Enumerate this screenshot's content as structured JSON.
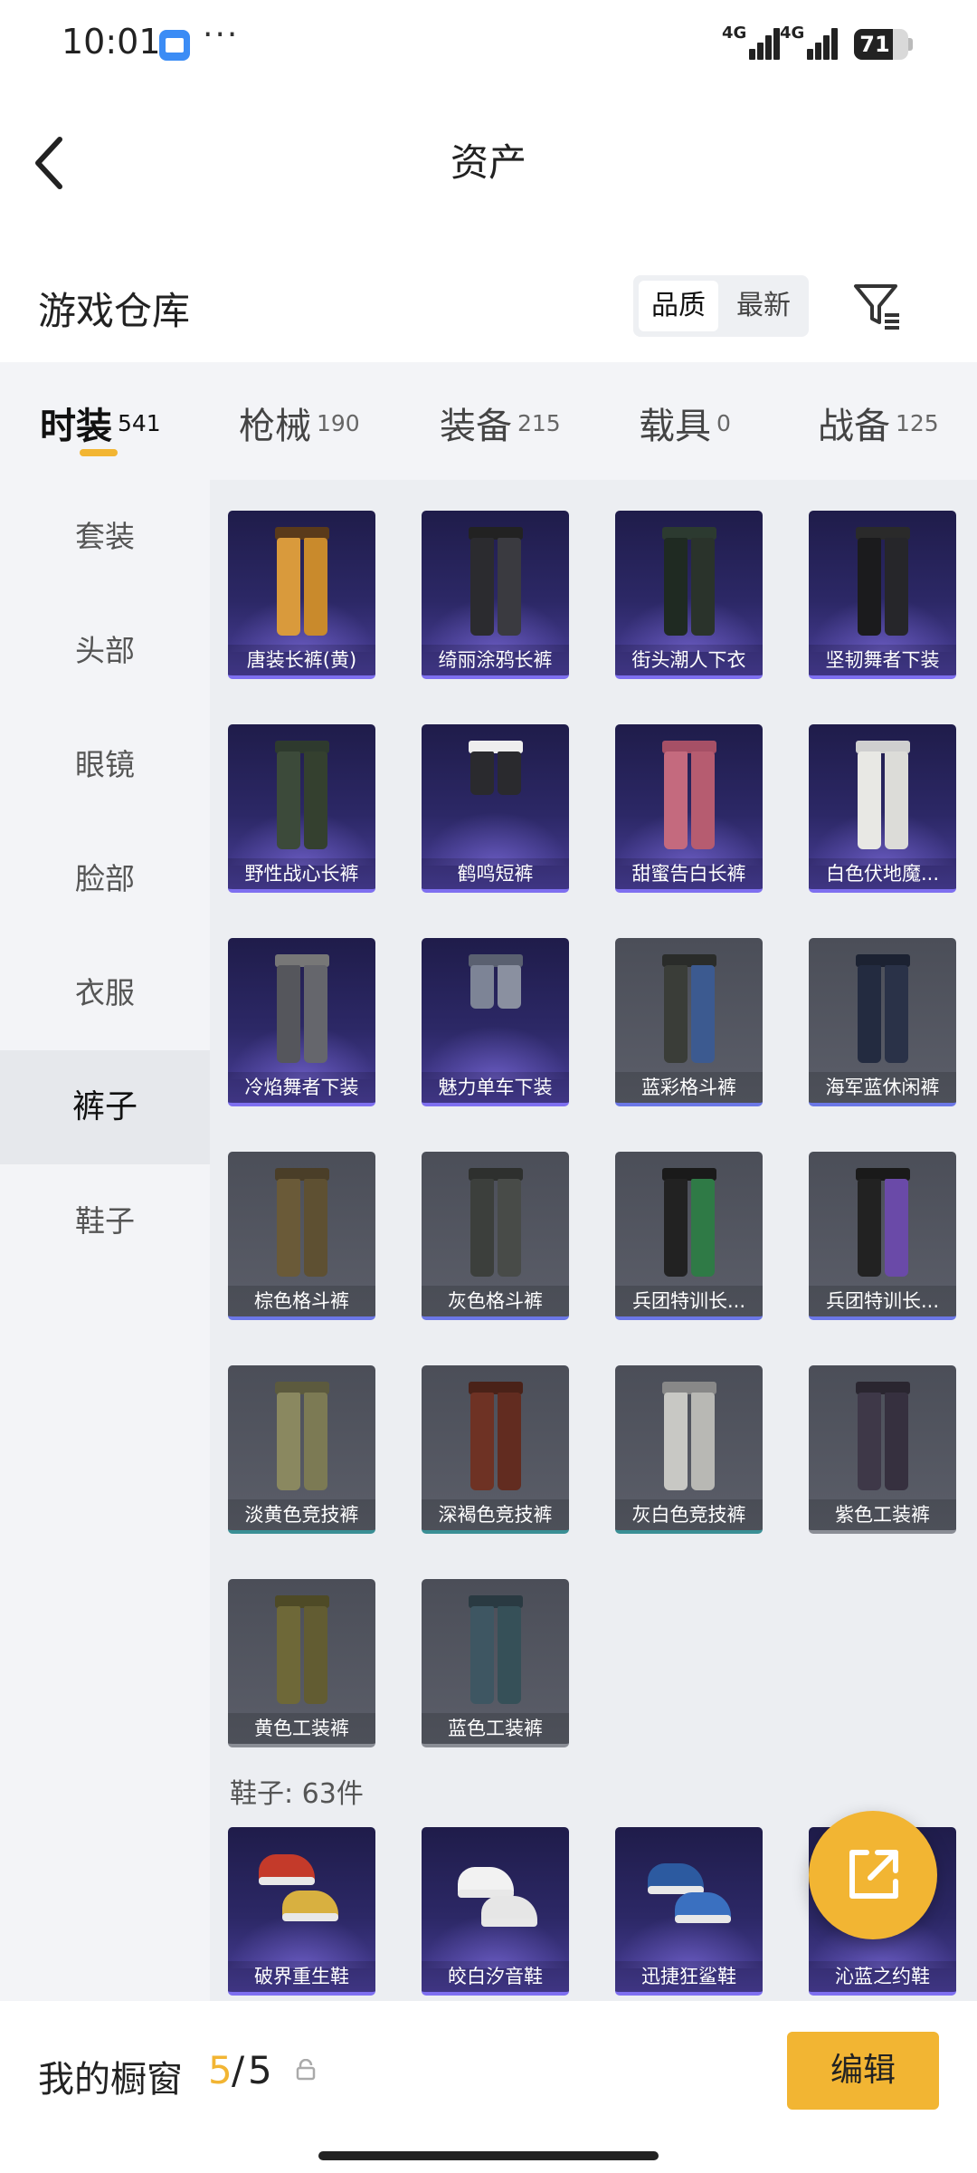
{
  "status_bar": {
    "time": "10:01",
    "more": "···",
    "signal1_label": "4G",
    "signal2_label": "4G",
    "battery": "71",
    "battery_level": 0.71
  },
  "header": {
    "title": "资产",
    "back_icon": "chevron-left-icon"
  },
  "warehouse": {
    "title": "游戏仓库",
    "sort_options": [
      "品质",
      "最新"
    ],
    "sort_selected": "品质",
    "filter_icon": "filter-icon"
  },
  "tabs": [
    {
      "label": "时装",
      "count": "541",
      "active": true
    },
    {
      "label": "枪械",
      "count": "190",
      "active": false
    },
    {
      "label": "装备",
      "count": "215",
      "active": false
    },
    {
      "label": "载具",
      "count": "0",
      "active": false
    },
    {
      "label": "战备",
      "count": "125",
      "active": false
    }
  ],
  "sidebar": [
    {
      "label": "套装",
      "active": false
    },
    {
      "label": "头部",
      "active": false
    },
    {
      "label": "眼镜",
      "active": false
    },
    {
      "label": "脸部",
      "active": false
    },
    {
      "label": "衣服",
      "active": false
    },
    {
      "label": "裤子",
      "active": true
    },
    {
      "label": "鞋子",
      "active": false
    }
  ],
  "pants_items": [
    {
      "name": "唐装长裤(黄)",
      "rarity": "purple"
    },
    {
      "name": "绮丽涂鸦长裤",
      "rarity": "purple"
    },
    {
      "name": "街头潮人下衣",
      "rarity": "purple"
    },
    {
      "name": "坚韧舞者下装",
      "rarity": "purple"
    },
    {
      "name": "野性战心长裤",
      "rarity": "purple"
    },
    {
      "name": "鹤鸣短裤",
      "rarity": "purple"
    },
    {
      "name": "甜蜜告白长裤",
      "rarity": "purple"
    },
    {
      "name": "白色伏地魔...",
      "rarity": "purple"
    },
    {
      "name": "冷焰舞者下装",
      "rarity": "purple"
    },
    {
      "name": "魅力单车下装",
      "rarity": "purple"
    },
    {
      "name": "蓝彩格斗裤",
      "rarity": "blue"
    },
    {
      "name": "海军蓝休闲裤",
      "rarity": "blue"
    },
    {
      "name": "棕色格斗裤",
      "rarity": "blue"
    },
    {
      "name": "灰色格斗裤",
      "rarity": "blue"
    },
    {
      "name": "兵团特训长...",
      "rarity": "blue"
    },
    {
      "name": "兵团特训长...",
      "rarity": "blue"
    },
    {
      "name": "淡黄色竞技裤",
      "rarity": "teal"
    },
    {
      "name": "深褐色竞技裤",
      "rarity": "teal"
    },
    {
      "name": "灰白色竞技裤",
      "rarity": "teal"
    },
    {
      "name": "紫色工装裤",
      "rarity": "gray"
    },
    {
      "name": "黄色工装裤",
      "rarity": "gray"
    },
    {
      "name": "蓝色工装裤",
      "rarity": "gray"
    }
  ],
  "shoes_section": {
    "label": "鞋子: 63件"
  },
  "shoes_items": [
    {
      "name": "破界重生鞋",
      "rarity": "purple"
    },
    {
      "name": "皎白汐音鞋",
      "rarity": "purple"
    },
    {
      "name": "迅捷狂鲨鞋",
      "rarity": "purple"
    },
    {
      "name": "沁蓝之约鞋",
      "rarity": "purple"
    }
  ],
  "fab": {
    "icon": "share-external-icon"
  },
  "showcase": {
    "title": "我的橱窗",
    "current": "5",
    "separator": "/",
    "max": "5",
    "lock_icon": "lock-icon",
    "edit_label": "编辑"
  },
  "colors": {
    "accent": "#f2b533",
    "purple_card": "#2c2866",
    "gray_card": "#555864"
  }
}
